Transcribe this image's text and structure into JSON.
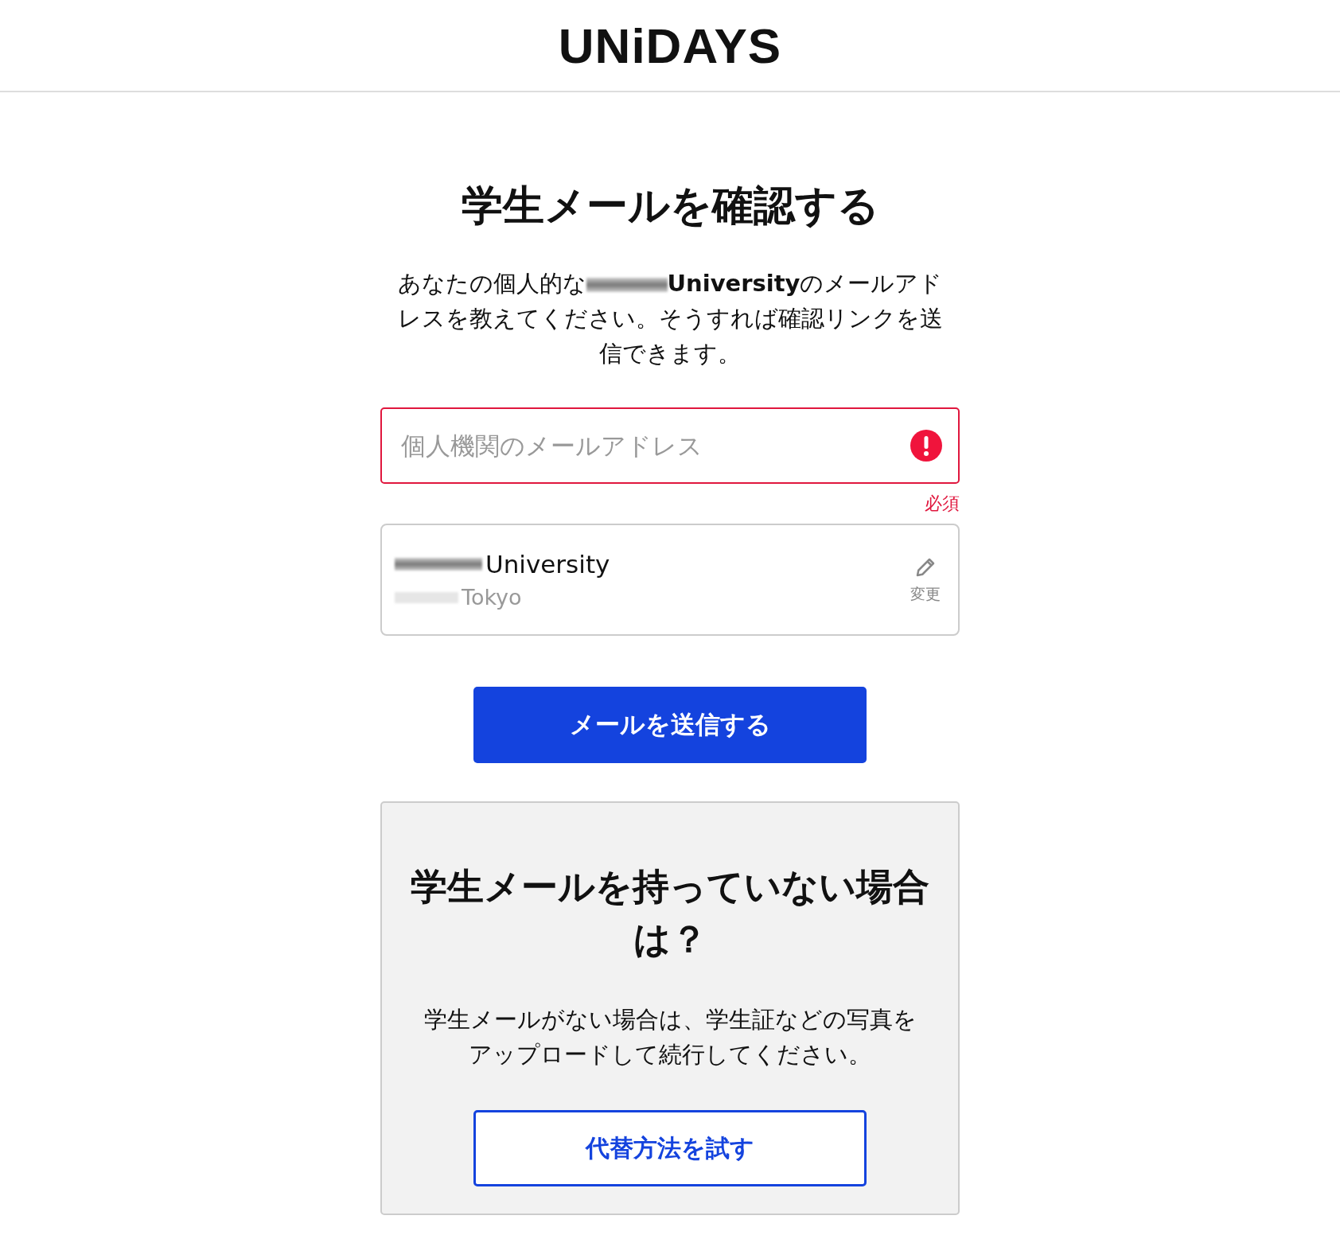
{
  "header": {
    "logo": "UNiDAYS"
  },
  "title": "学生メールを確認する",
  "intro": {
    "before": "あなたの個人的な",
    "after": "**University**のメールアドレスを教えてください。そうすれば確認リンクを送信できます。"
  },
  "email_field": {
    "placeholder": "個人機関のメールアドレス",
    "error": true,
    "error_text": "必須"
  },
  "institution": {
    "name": "University",
    "location": "Tokyo",
    "change_label": "変更"
  },
  "send_button": "メールを送信する",
  "alt_card": {
    "title": "学生メールを持っていない場合は？",
    "text": "学生メールがない場合は、学生証などの写真をアップロードして続行してください。",
    "button": "代替方法を試す"
  }
}
